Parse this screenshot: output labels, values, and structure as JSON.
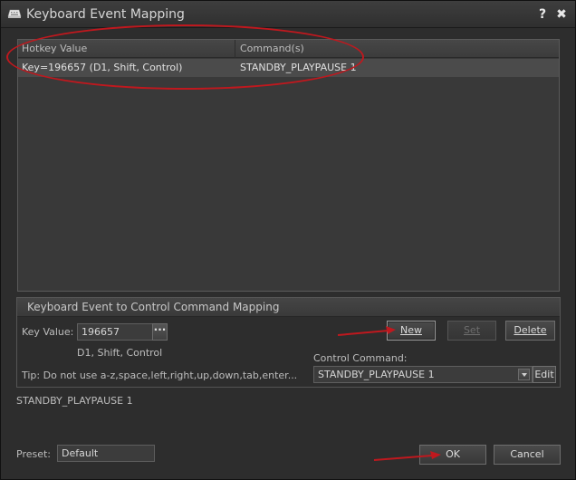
{
  "window": {
    "title": "Keyboard Event Mapping",
    "help_glyph": "?",
    "close_glyph": "✖"
  },
  "table": {
    "columns": [
      "Hotkey Value",
      "Command(s)"
    ],
    "rows": [
      {
        "hotkey": "Key=196657 (D1, Shift, Control)",
        "command": "STANDBY_PLAYPAUSE 1"
      }
    ]
  },
  "mapping": {
    "title": "Keyboard Event to Control Command Mapping",
    "key_value_label": "Key Value:",
    "key_value": "196657",
    "browse_glyph": "···",
    "key_description": "D1, Shift, Control",
    "new_label": "New",
    "set_label": "Set",
    "delete_label": "Delete",
    "control_command_label": "Control Command:",
    "control_command_value": "STANDBY_PLAYPAUSE 1",
    "edit_label": "Edit",
    "tip": "Tip: Do not use a-z,space,left,right,up,down,tab,enter..."
  },
  "status_text": "STANDBY_PLAYPAUSE 1",
  "footer": {
    "preset_label": "Preset:",
    "preset_value": "Default",
    "ok_label": "OK",
    "cancel_label": "Cancel"
  },
  "colors": {
    "annotation_red": "#c0181e",
    "window_bg": "#2d2d2d",
    "selected_row": "#4b4b4b"
  },
  "icons": {
    "app": "keyboard-icon",
    "help": "help-icon",
    "close": "close-icon"
  }
}
